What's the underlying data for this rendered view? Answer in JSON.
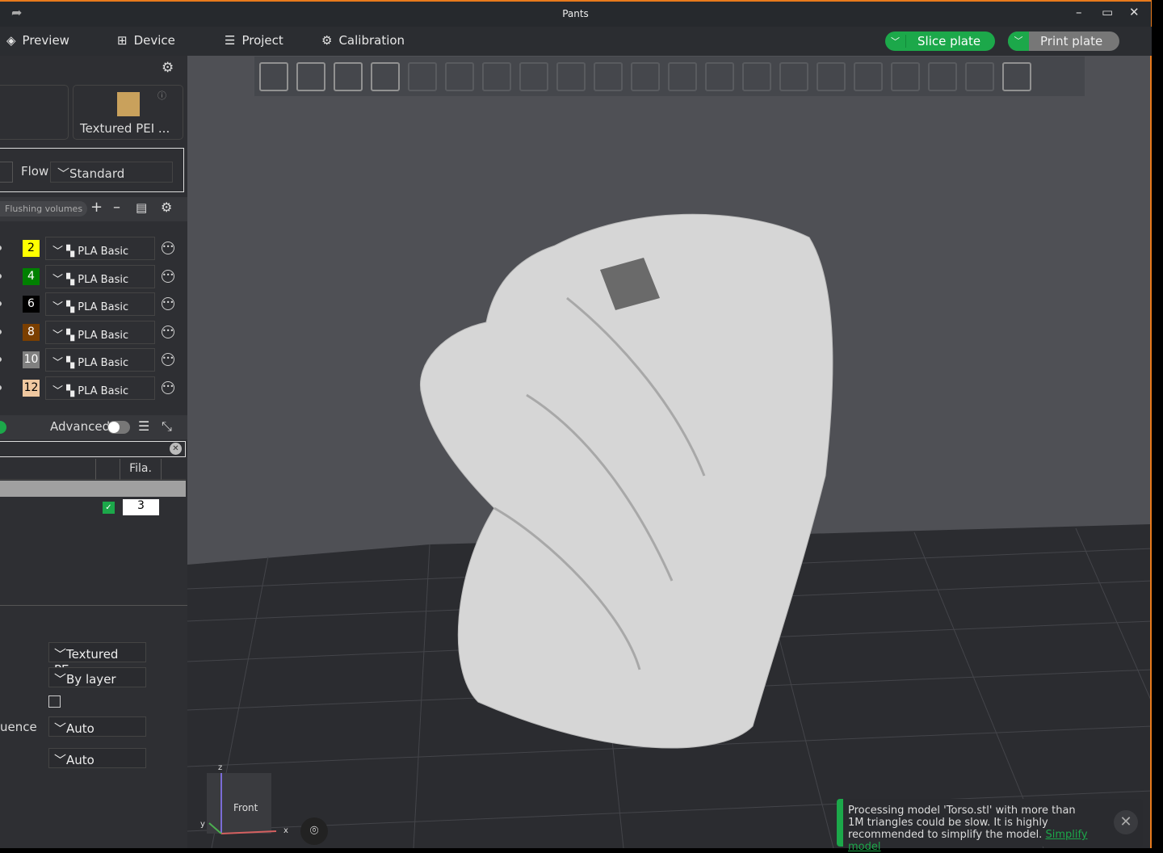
{
  "window": {
    "title": "Pants"
  },
  "menu": [
    {
      "label": "Preview",
      "icon": "layers-icon"
    },
    {
      "label": "Device",
      "icon": "device-icon"
    },
    {
      "label": "Project",
      "icon": "project-icon"
    },
    {
      "label": "Calibration",
      "icon": "calibration-icon"
    }
  ],
  "actions": {
    "slice": "Slice plate",
    "print": "Print plate"
  },
  "plate": {
    "label": "Textured PEI ..."
  },
  "flow": {
    "label": "Flow",
    "value": "Standard"
  },
  "filament": {
    "flushing": "Flushing volumes",
    "items": [
      {
        "num": "2",
        "color": "#ffff00",
        "text": "#000",
        "name": "PLA Basic"
      },
      {
        "num": "4",
        "color": "#008000",
        "text": "#fff",
        "name": "PLA Basic"
      },
      {
        "num": "6",
        "color": "#000000",
        "text": "#fff",
        "name": "PLA Basic"
      },
      {
        "num": "8",
        "color": "#7b3f00",
        "text": "#fff",
        "name": "PLA Basic"
      },
      {
        "num": "10",
        "color": "#808080",
        "text": "#fff",
        "name": "PLA Basic"
      },
      {
        "num": "12",
        "color": "#f0c8a0",
        "text": "#000",
        "name": "PLA Basic"
      }
    ]
  },
  "objects": {
    "advanced": "Advanced",
    "advanced_on": false,
    "col_fila": "Fila.",
    "row_fila": "3",
    "row_checked": true
  },
  "settings": {
    "plate_type": "Textured PE...",
    "seq": "By layer",
    "seq_label": "uence",
    "auto1": "Auto",
    "auto2": "Auto"
  },
  "view": {
    "cube_label": "Front",
    "axis_x": "x",
    "axis_y": "y",
    "axis_z": "z"
  },
  "toast": {
    "text": "Processing model 'Torso.stl' with more than 1M triangles could be slow. It is highly recommended to simplify the model.",
    "link": "Simplify model"
  },
  "colors": {
    "accent": "#1ca84a",
    "border": "#e87a1c"
  }
}
